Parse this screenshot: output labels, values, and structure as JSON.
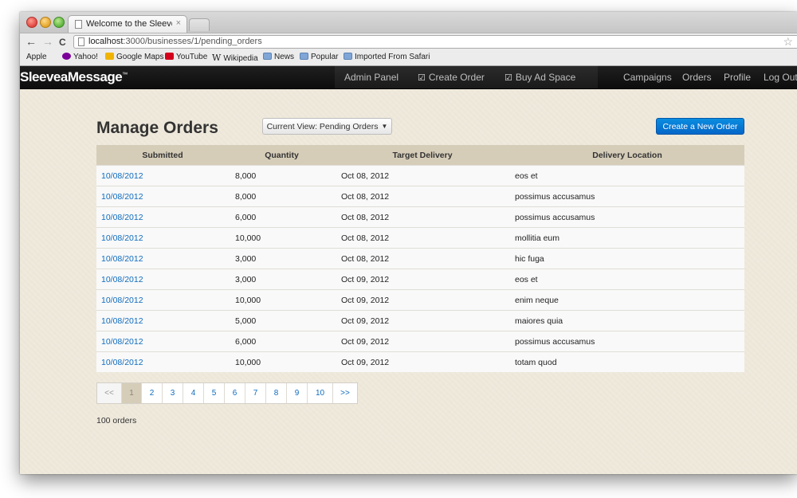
{
  "browser": {
    "tab_title": "Welcome to the Sleeve A Me:",
    "tab_close": "×",
    "url_host": "localhost",
    "url_path": ":3000/businesses/1/pending_orders",
    "nav": {
      "back": "←",
      "forward": "→",
      "reload": "C"
    },
    "star": "☆",
    "bookmarks": [
      {
        "label": "Apple",
        "icon": "apple-icon"
      },
      {
        "label": "Yahoo!",
        "icon": "yahoo-icon"
      },
      {
        "label": "Google Maps",
        "icon": "google-maps-icon"
      },
      {
        "label": "YouTube",
        "icon": "youtube-icon"
      },
      {
        "label": "Wikipedia",
        "icon": "wikipedia-icon"
      },
      {
        "label": "News",
        "icon": "folder-icon"
      },
      {
        "label": "Popular",
        "icon": "folder-icon"
      },
      {
        "label": "Imported From Safari",
        "icon": "folder-icon"
      }
    ]
  },
  "app": {
    "brand": "SleeveaMessage",
    "brand_tm": "™",
    "nav": {
      "admin_panel": "Admin Panel",
      "create_order": "Create Order",
      "buy_ad_space": "Buy Ad Space",
      "campaigns": "Campaigns",
      "orders": "Orders",
      "profile": "Profile",
      "log_out": "Log Out"
    }
  },
  "page": {
    "title": "Manage Orders",
    "view_dropdown": "Current View: Pending Orders",
    "create_button": "Create a New Order",
    "columns": [
      "Submitted",
      "Quantity",
      "Target Delivery",
      "Delivery Location"
    ],
    "rows": [
      {
        "submitted": "10/08/2012",
        "quantity": "8,000",
        "target": "Oct 08, 2012",
        "location": "eos et"
      },
      {
        "submitted": "10/08/2012",
        "quantity": "8,000",
        "target": "Oct 08, 2012",
        "location": "possimus accusamus"
      },
      {
        "submitted": "10/08/2012",
        "quantity": "6,000",
        "target": "Oct 08, 2012",
        "location": "possimus accusamus"
      },
      {
        "submitted": "10/08/2012",
        "quantity": "10,000",
        "target": "Oct 08, 2012",
        "location": "mollitia eum"
      },
      {
        "submitted": "10/08/2012",
        "quantity": "3,000",
        "target": "Oct 08, 2012",
        "location": "hic fuga"
      },
      {
        "submitted": "10/08/2012",
        "quantity": "3,000",
        "target": "Oct 09, 2012",
        "location": "eos et"
      },
      {
        "submitted": "10/08/2012",
        "quantity": "10,000",
        "target": "Oct 09, 2012",
        "location": "enim neque"
      },
      {
        "submitted": "10/08/2012",
        "quantity": "5,000",
        "target": "Oct 09, 2012",
        "location": "maiores quia"
      },
      {
        "submitted": "10/08/2012",
        "quantity": "6,000",
        "target": "Oct 09, 2012",
        "location": "possimus accusamus"
      },
      {
        "submitted": "10/08/2012",
        "quantity": "10,000",
        "target": "Oct 09, 2012",
        "location": "totam quod"
      }
    ],
    "pagination": {
      "prev": "<<",
      "pages": [
        "1",
        "2",
        "3",
        "4",
        "5",
        "6",
        "7",
        "8",
        "9",
        "10"
      ],
      "next": ">>",
      "current": "1"
    },
    "count": "100 orders"
  }
}
